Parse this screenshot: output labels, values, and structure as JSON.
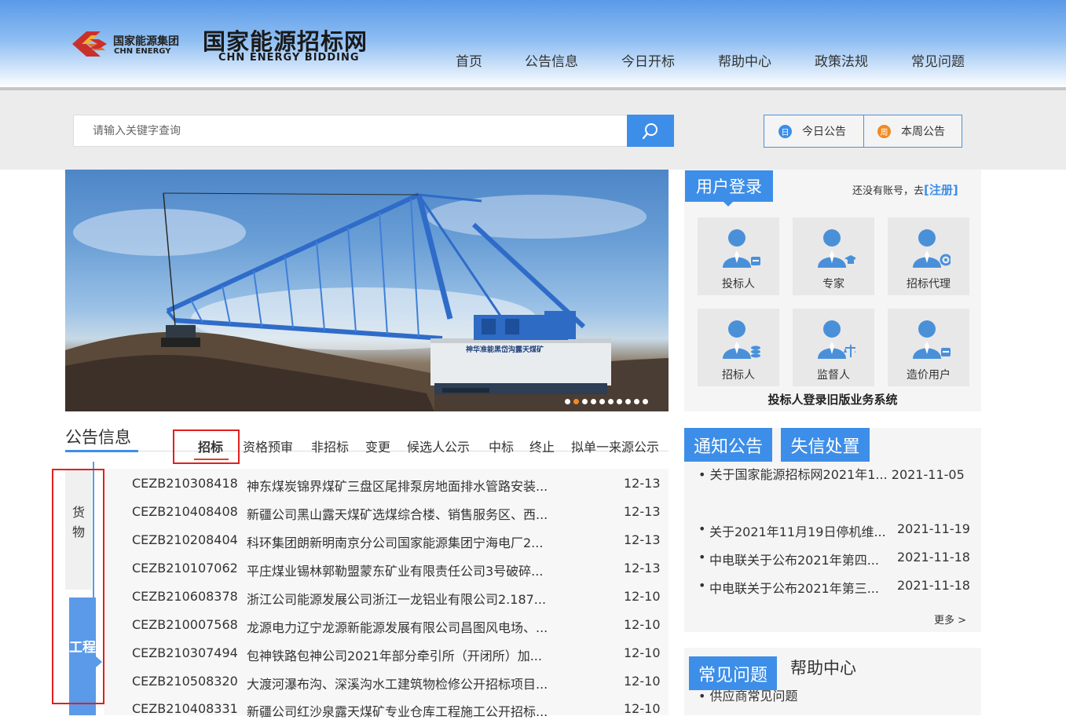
{
  "brand": {
    "group_cn": "国家能源集团",
    "group_en": "CHN ENERGY",
    "site_title": "国家能源招标网",
    "site_subtitle": "CHN ENERGY BIDDING"
  },
  "nav": {
    "items": [
      "首页",
      "公告信息",
      "今日开标",
      "帮助中心",
      "政策法规",
      "常见问题"
    ]
  },
  "search": {
    "placeholder": "请输入关键字查询",
    "today_label": "今日公告",
    "today_icon_char": "日",
    "week_label": "本周公告",
    "week_icon_char": "周"
  },
  "banner": {
    "machine_text": "神华准能黑岱沟露天煤矿",
    "dot_count": 10
  },
  "announcements": {
    "title": "公告信息",
    "tabs": [
      "招标",
      "资格预审",
      "非招标",
      "变更",
      "候选人公示",
      "中标",
      "终止",
      "拟单一来源公示"
    ],
    "side_goods": "货物",
    "side_engineering": "工程",
    "rows": [
      {
        "code": "CEZB210308418",
        "title": "神东煤炭锦界煤矿三盘区尾排泵房地面排水管路安装...",
        "date": "12-13"
      },
      {
        "code": "CEZB210408408",
        "title": "新疆公司黑山露天煤矿选煤综合楼、销售服务区、西...",
        "date": "12-13"
      },
      {
        "code": "CEZB210208404",
        "title": "科环集团朗新明南京分公司国家能源集团宁海电厂2...",
        "date": "12-13"
      },
      {
        "code": "CEZB210107062",
        "title": "平庄煤业锡林郭勒盟蒙东矿业有限责任公司3号破碎...",
        "date": "12-13"
      },
      {
        "code": "CEZB210608378",
        "title": "浙江公司能源发展公司浙江一龙铝业有限公司2.187...",
        "date": "12-10"
      },
      {
        "code": "CEZB210007568",
        "title": "龙源电力辽宁龙源新能源发展有限公司昌图风电场、...",
        "date": "12-10"
      },
      {
        "code": "CEZB210307494",
        "title": "包神铁路包神公司2021年部分牵引所（开闭所）加...",
        "date": "12-10"
      },
      {
        "code": "CEZB210508320",
        "title": "大渡河瀑布沟、深溪沟水工建筑物检修公开招标项目...",
        "date": "12-10"
      },
      {
        "code": "CEZB210408331",
        "title": "新疆公司红沙泉露天煤矿专业仓库工程施工公开招标...",
        "date": "12-10"
      }
    ]
  },
  "login": {
    "title": "用户登录",
    "register_prompt": "还没有账号，去",
    "register_link": "[注册]",
    "roles": [
      "投标人",
      "专家",
      "招标代理",
      "招标人",
      "监督人",
      "造价用户"
    ],
    "old_system": "投标人登录旧版业务系统"
  },
  "notices": {
    "tab_notice": "通知公告",
    "tab_credit": "失信处置",
    "partial_top": "• 关于国家能源招标网2021年1...   2021-11-05",
    "rows": [
      {
        "title": "关于2021年11月19日停机维...",
        "date": "2021-11-19"
      },
      {
        "title": "中电联关于公布2021年第四...",
        "date": "2021-11-18"
      },
      {
        "title": "中电联关于公布2021年第三...",
        "date": "2021-11-18"
      }
    ],
    "more": "更多 >"
  },
  "faq": {
    "tab_faq": "常见问题",
    "tab_help": "帮助中心",
    "partial_item": "• 供应商常见问题"
  },
  "colors": {
    "accent": "#3d8ee8",
    "highlight_box": "#e02020",
    "active_tab_line": "#c94a2e",
    "today_icon": "#3d8ee8",
    "week_icon": "#f08a24"
  }
}
